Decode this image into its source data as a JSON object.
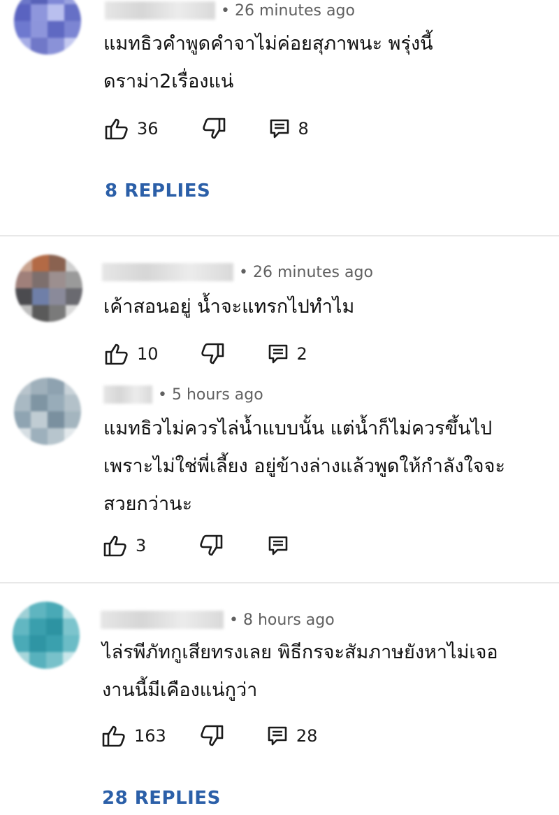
{
  "comments": [
    {
      "timestamp": "• 26 minutes ago",
      "lines": [
        "แมทธิวคำพูดคำจาไม่ค่อยสุภาพนะ พรุ่งนี้",
        "ดราม่า2เรื่องแน่"
      ],
      "likes": "36",
      "replies_count": "8",
      "replies_link": "8 REPLIES",
      "avatar_colors": [
        "#6d78c9",
        "#5862b8",
        "#7f88d6",
        "#9aa2e0",
        "#5a63c0",
        "#8e96dc",
        "#b9bfee",
        "#6670c6",
        "#6e79cf",
        "#8d95db",
        "#5f69c2",
        "#7c85d3",
        "#a6ade6",
        "#7078c8",
        "#8a92d8",
        "#c4c9f0"
      ]
    },
    {
      "timestamp": "• 26 minutes ago",
      "lines": [
        "เค้าสอนอยู่ น้ำจะแทรกไปทำไม"
      ],
      "likes": "10",
      "replies_count": "2",
      "avatar_colors": [
        "#c9a38f",
        "#b36a45",
        "#8a6250",
        "#cfcfcf",
        "#a0807a",
        "#7d6f6d",
        "#9c8f8f",
        "#9a9a9a",
        "#4b4b4f",
        "#6f7fa8",
        "#8a8a9a",
        "#6a6a70",
        "#bdbdbd",
        "#5a5a5a",
        "#7a7a7a",
        "#d9d9d9"
      ]
    },
    {
      "timestamp": "• 5 hours ago",
      "lines": [
        "แมทธิวไม่ควรไล่น้ำแบบนั้น แต่น้ำก็ไม่ควรขึ้นไป",
        "เพราะไม่ใช่พี่เลี้ยง อยู่ข้างล่างแล้วพูดให้กำลังใจจะ",
        "สวยกว่านะ"
      ],
      "likes": "3",
      "replies_count": "",
      "avatar_colors": [
        "#b8c4cc",
        "#9fb0bb",
        "#8ea2b0",
        "#c9d3d9",
        "#a9b9c3",
        "#7f95a3",
        "#98acb9",
        "#b3c1c9",
        "#8fa4b2",
        "#c0ccd3",
        "#7a909f",
        "#a4b5bf",
        "#d6dee3",
        "#9db0bc",
        "#b7c5cd",
        "#e2e8eb"
      ]
    },
    {
      "timestamp": "• 8 hours ago",
      "lines": [
        "ไล่รพีภัทกูเสียทรงเลย พิธีกรจะสัมภาษยังหาไม่เจอ",
        "งานนี้มีเคืองแน่กูว่า"
      ],
      "likes": "163",
      "replies_count": "28",
      "replies_link": "28 REPLIES",
      "avatar_colors": [
        "#9fd0d6",
        "#5fb5c0",
        "#49a9b6",
        "#b9e0e4",
        "#62b7c2",
        "#3a9fad",
        "#2d93a2",
        "#7cc4cd",
        "#4aaab7",
        "#2f95a4",
        "#3aa0ae",
        "#6bbcc6",
        "#a7d6db",
        "#58b1bd",
        "#78c1ca",
        "#c9e7ea"
      ]
    }
  ]
}
